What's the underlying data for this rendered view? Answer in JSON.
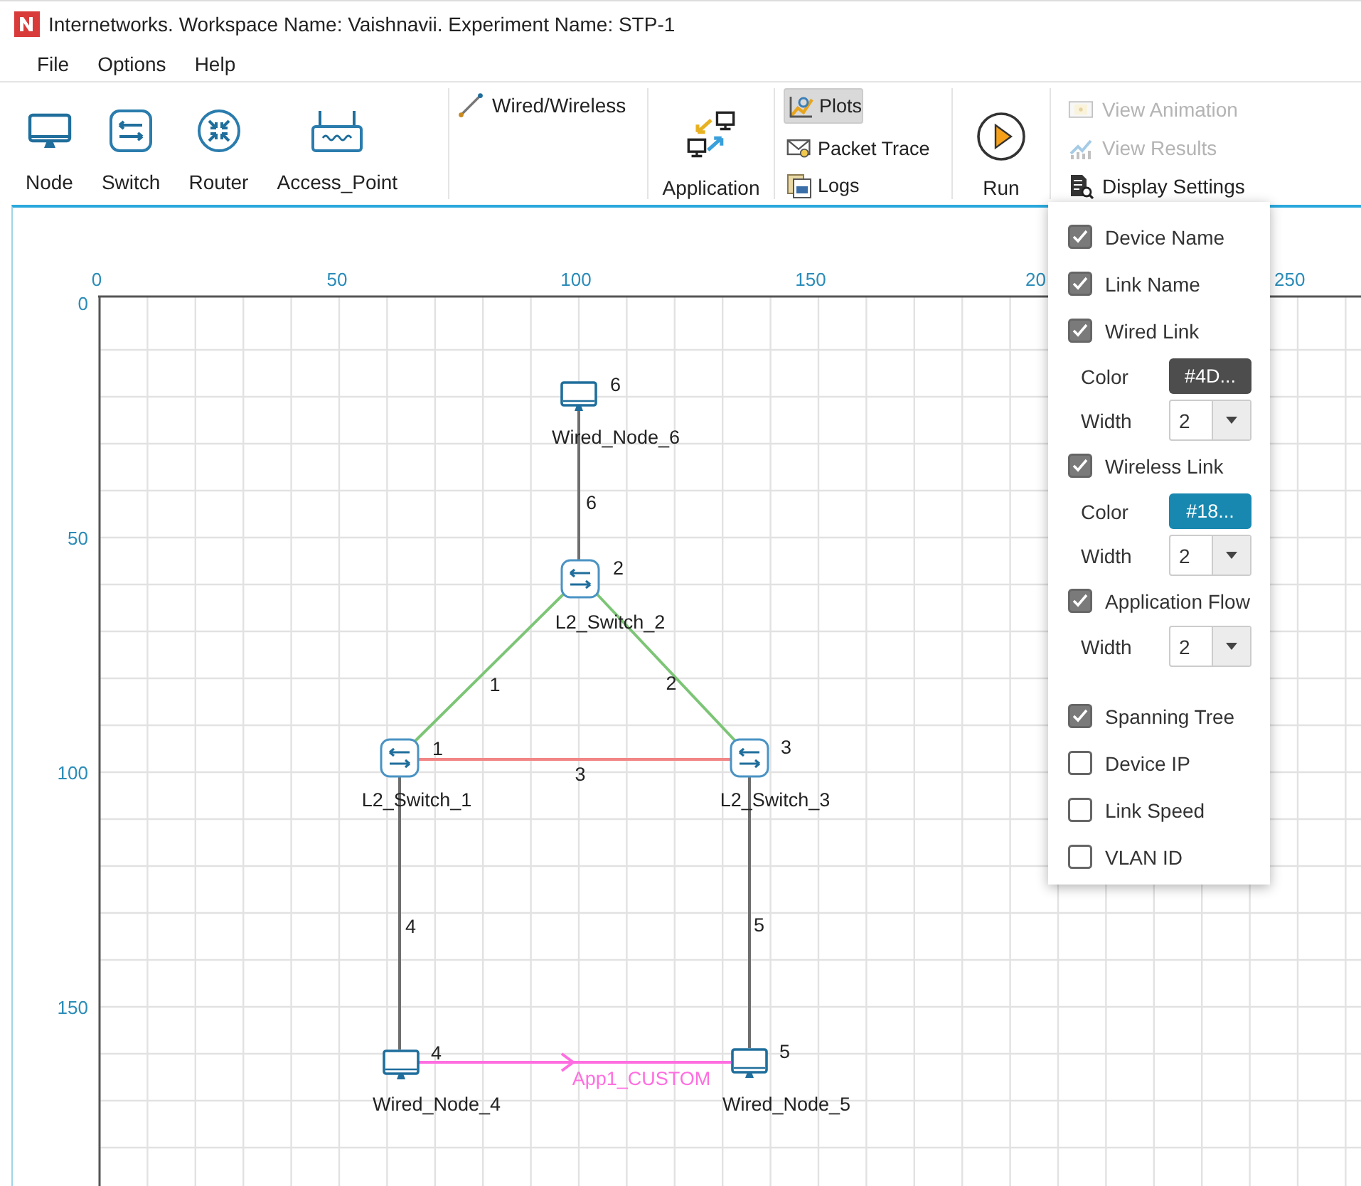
{
  "window": {
    "title": "Internetworks. Workspace Name: Vaishnavii. Experiment Name: STP-1"
  },
  "menu": [
    "File",
    "Options",
    "Help"
  ],
  "toolbar": {
    "devices": [
      {
        "label": "Node",
        "kind": "node"
      },
      {
        "label": "Switch",
        "kind": "switch"
      },
      {
        "label": "Router",
        "kind": "router"
      },
      {
        "label": "Access_Point",
        "kind": "access_point"
      }
    ],
    "link_tool": "Wired/Wireless",
    "application": "Application",
    "analysis": [
      {
        "label": "Plots",
        "kind": "plots",
        "selected": true
      },
      {
        "label": "Packet Trace",
        "kind": "packet_trace",
        "selected": false
      },
      {
        "label": "Logs",
        "kind": "logs",
        "selected": false
      }
    ],
    "run": "Run",
    "view": [
      {
        "label": "View Animation",
        "kind": "animation",
        "disabled": true
      },
      {
        "label": "View Results",
        "kind": "results",
        "disabled": true
      },
      {
        "label": "Display Settings",
        "kind": "display",
        "disabled": false
      }
    ]
  },
  "canvas": {
    "x_labels": [
      "0",
      "50",
      "100",
      "150",
      "20",
      "250"
    ],
    "y_labels": [
      "0",
      "50",
      "100",
      "150"
    ],
    "nodes": [
      {
        "name": "Wired_Node_6",
        "number": "6",
        "kind": "wired_node"
      },
      {
        "name": "L2_Switch_2",
        "number": "2",
        "kind": "switch"
      },
      {
        "name": "L2_Switch_1",
        "number": "1",
        "kind": "switch"
      },
      {
        "name": "L2_Switch_3",
        "number": "3",
        "kind": "switch"
      },
      {
        "name": "Wired_Node_4",
        "number": "4",
        "kind": "wired_node"
      },
      {
        "name": "Wired_Node_5",
        "number": "5",
        "kind": "wired_node"
      }
    ],
    "links": [
      {
        "label": "6",
        "color": "#6e6e6e"
      },
      {
        "label": "1",
        "color": "#7cc576"
      },
      {
        "label": "2",
        "color": "#7cc576"
      },
      {
        "label": "3",
        "color": "#f28585"
      },
      {
        "label": "4",
        "color": "#6e6e6e"
      },
      {
        "label": "5",
        "color": "#6e6e6e"
      }
    ],
    "application_flow": {
      "name": "App1_CUSTOM"
    }
  },
  "display_settings": {
    "items": [
      {
        "kind": "checkbox",
        "label": "Device Name",
        "checked": true
      },
      {
        "kind": "checkbox",
        "label": "Link Name",
        "checked": true
      },
      {
        "kind": "checkbox",
        "label": "Wired Link",
        "checked": true
      },
      {
        "kind": "color",
        "label": "Color",
        "value": "#4D...",
        "color": "#4d4d4d"
      },
      {
        "kind": "width",
        "label": "Width",
        "value": "2"
      },
      {
        "kind": "checkbox",
        "label": "Wireless Link",
        "checked": true
      },
      {
        "kind": "color",
        "label": "Color",
        "value": "#18...",
        "color": "#1888b0"
      },
      {
        "kind": "width",
        "label": "Width",
        "value": "2"
      },
      {
        "kind": "checkbox",
        "label": "Application Flow",
        "checked": true
      },
      {
        "kind": "width",
        "label": "Width",
        "value": "2"
      },
      {
        "kind": "spacer"
      },
      {
        "kind": "checkbox",
        "label": "Spanning Tree",
        "checked": true
      },
      {
        "kind": "checkbox",
        "label": "Device IP",
        "checked": false
      },
      {
        "kind": "checkbox",
        "label": "Link Speed",
        "checked": false
      },
      {
        "kind": "checkbox",
        "label": "VLAN ID",
        "checked": false
      }
    ]
  }
}
